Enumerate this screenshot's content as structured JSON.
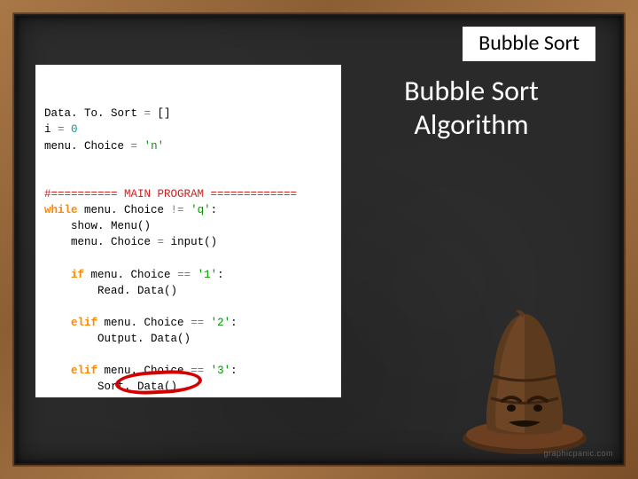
{
  "slide": {
    "title": "Bubble Sort",
    "heading": "Bubble Sort Algorithm"
  },
  "code": {
    "lines": [
      [
        {
          "t": "Data. To. Sort ",
          "c": "tok-default"
        },
        {
          "t": "=",
          "c": "tok-op"
        },
        {
          "t": " []",
          "c": "tok-default"
        }
      ],
      [
        {
          "t": "i ",
          "c": "tok-default"
        },
        {
          "t": "=",
          "c": "tok-op"
        },
        {
          "t": " ",
          "c": "tok-default"
        },
        {
          "t": "0",
          "c": "tok-num"
        }
      ],
      [
        {
          "t": "menu. Choice ",
          "c": "tok-default"
        },
        {
          "t": "=",
          "c": "tok-op"
        },
        {
          "t": " ",
          "c": "tok-default"
        },
        {
          "t": "'n'",
          "c": "tok-str"
        }
      ],
      [],
      [],
      [
        {
          "t": "#========== MAIN PROGRAM =============",
          "c": "tok-comment"
        }
      ],
      [
        {
          "t": "while",
          "c": "tok-kw"
        },
        {
          "t": " menu. Choice ",
          "c": "tok-default"
        },
        {
          "t": "!=",
          "c": "tok-op"
        },
        {
          "t": " ",
          "c": "tok-default"
        },
        {
          "t": "'q'",
          "c": "tok-str"
        },
        {
          "t": ":",
          "c": "tok-default"
        }
      ],
      [
        {
          "t": "    show. Menu",
          "c": "tok-default"
        },
        {
          "t": "()",
          "c": "tok-default"
        }
      ],
      [
        {
          "t": "    menu. Choice ",
          "c": "tok-default"
        },
        {
          "t": "=",
          "c": "tok-op"
        },
        {
          "t": " ",
          "c": "tok-default"
        },
        {
          "t": "input",
          "c": "tok-default"
        },
        {
          "t": "()",
          "c": "tok-default"
        }
      ],
      [],
      [
        {
          "t": "    ",
          "c": "tok-default"
        },
        {
          "t": "if",
          "c": "tok-kw"
        },
        {
          "t": " menu. Choice ",
          "c": "tok-default"
        },
        {
          "t": "==",
          "c": "tok-op"
        },
        {
          "t": " ",
          "c": "tok-default"
        },
        {
          "t": "'1'",
          "c": "tok-str"
        },
        {
          "t": ":",
          "c": "tok-default"
        }
      ],
      [
        {
          "t": "        Read. Data",
          "c": "tok-default"
        },
        {
          "t": "()",
          "c": "tok-default"
        }
      ],
      [],
      [
        {
          "t": "    ",
          "c": "tok-default"
        },
        {
          "t": "elif",
          "c": "tok-kw"
        },
        {
          "t": " menu. Choice ",
          "c": "tok-default"
        },
        {
          "t": "==",
          "c": "tok-op"
        },
        {
          "t": " ",
          "c": "tok-default"
        },
        {
          "t": "'2'",
          "c": "tok-str"
        },
        {
          "t": ":",
          "c": "tok-default"
        }
      ],
      [
        {
          "t": "        Output. Data",
          "c": "tok-default"
        },
        {
          "t": "()",
          "c": "tok-default"
        }
      ],
      [],
      [
        {
          "t": "    ",
          "c": "tok-default"
        },
        {
          "t": "elif",
          "c": "tok-kw"
        },
        {
          "t": " menu. Choice ",
          "c": "tok-default"
        },
        {
          "t": "==",
          "c": "tok-op"
        },
        {
          "t": " ",
          "c": "tok-default"
        },
        {
          "t": "'3'",
          "c": "tok-str"
        },
        {
          "t": ":",
          "c": "tok-default"
        }
      ],
      [
        {
          "t": "        Sort. Data",
          "c": "tok-default"
        },
        {
          "t": "()",
          "c": "tok-default"
        }
      ]
    ]
  },
  "decor": {
    "hat_name": "sorting-hat-icon",
    "watermark": "graphicpanic.com"
  }
}
